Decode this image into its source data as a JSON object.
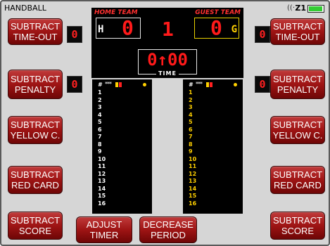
{
  "app": {
    "title": "HANDBALL"
  },
  "status": {
    "zone": "Z1",
    "battery_icon": "battery-icon",
    "wifi_icon": "wifi-icon"
  },
  "scoreboard": {
    "home_label": "HOME TEAM",
    "guest_label": "GUEST TEAM",
    "home_side": "H",
    "guest_side": "G",
    "home_score": "0",
    "guest_score": "0",
    "period": "1",
    "timer": "0↑00",
    "time_label": "TIME"
  },
  "home_panel": {
    "header": "#",
    "stars": "***",
    "players": [
      "1",
      "2",
      "3",
      "4",
      "5",
      "6",
      "7",
      "8",
      "9",
      "10",
      "11",
      "12",
      "13",
      "14",
      "15",
      "16"
    ]
  },
  "guest_panel": {
    "header": "#",
    "stars": "***",
    "players": [
      "1",
      "2",
      "3",
      "4",
      "5",
      "6",
      "7",
      "8",
      "9",
      "10",
      "11",
      "12",
      "13",
      "14",
      "15",
      "16"
    ]
  },
  "left_buttons": {
    "timeout": {
      "line1": "SUBTRACT",
      "line2": "TIME-OUT",
      "count": "0"
    },
    "penalty": {
      "line1": "SUBTRACT",
      "line2": "PENALTY",
      "count": "0"
    },
    "yellow": {
      "line1": "SUBTRACT",
      "line2": "YELLOW C."
    },
    "red": {
      "line1": "SUBTRACT",
      "line2": "RED CARD"
    },
    "score": {
      "line1": "SUBTRACT",
      "line2": "SCORE"
    }
  },
  "right_buttons": {
    "timeout": {
      "line1": "SUBTRACT",
      "line2": "TIME-OUT",
      "count": "0"
    },
    "penalty": {
      "line1": "SUBTRACT",
      "line2": "PENALTY",
      "count": "0"
    },
    "yellow": {
      "line1": "SUBTRACT",
      "line2": "YELLOW C."
    },
    "red": {
      "line1": "SUBTRACT",
      "line2": "RED CARD"
    },
    "score": {
      "line1": "SUBTRACT",
      "line2": "SCORE"
    }
  },
  "bottom_buttons": {
    "adjust_timer": {
      "line1": "ADJUST",
      "line2": "TIMER"
    },
    "decrease_period": {
      "line1": "DECREASE",
      "line2": "PERIOD"
    }
  },
  "colors": {
    "button_red": "#9e1414",
    "digit_red": "#ff1a1a",
    "guest_yellow": "#ffd000",
    "background": "#d6d6d6"
  }
}
